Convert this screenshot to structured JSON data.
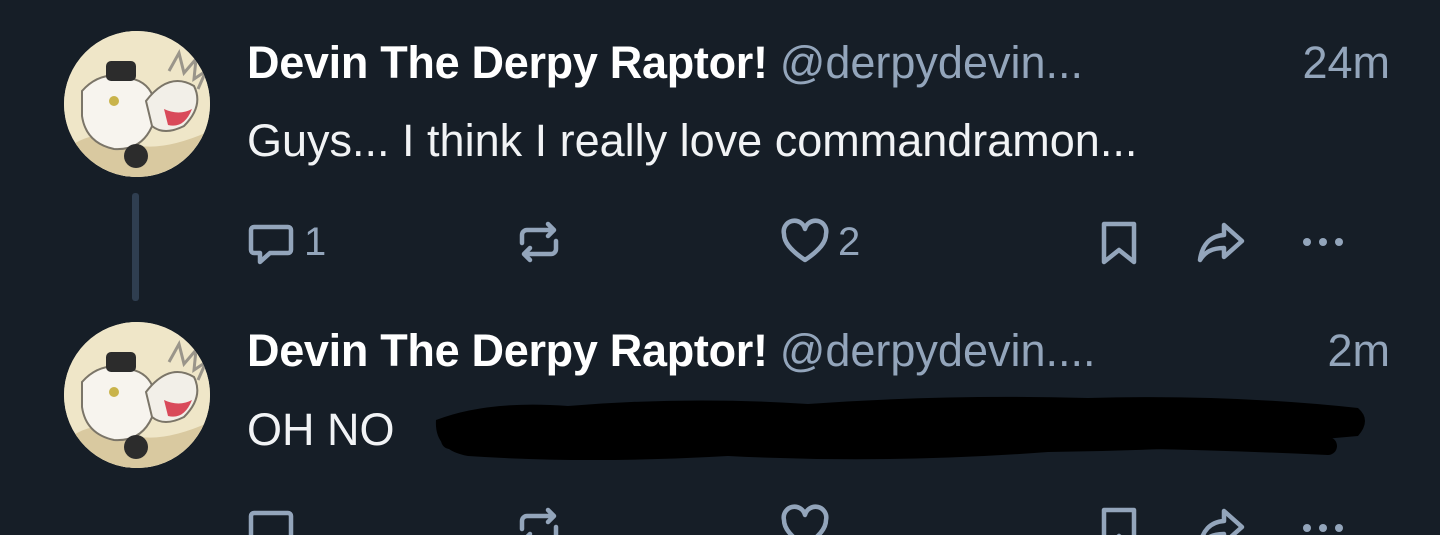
{
  "posts": [
    {
      "author": {
        "display_name": "Devin The Derpy Raptor!",
        "handle": "@derpydevin...",
        "avatar_icon": "raptor-avatar"
      },
      "timestamp": "24m",
      "text": "Guys... I think I really love commandramon...",
      "actions": {
        "reply_count": "1",
        "repost_count": "",
        "like_count": "2"
      }
    },
    {
      "author": {
        "display_name": "Devin The Derpy Raptor!",
        "handle": "@derpydevin....",
        "avatar_icon": "raptor-avatar"
      },
      "timestamp": "2m",
      "text": "OH NO",
      "redacted": true,
      "actions": {
        "reply_count": "",
        "repost_count": "",
        "like_count": ""
      }
    }
  ],
  "icons": {
    "reply": "reply-icon",
    "repost": "repost-icon",
    "like": "heart-icon",
    "save": "bookmark-icon",
    "share": "share-icon",
    "more": "more-icon"
  },
  "colors": {
    "background": "#161e27",
    "primary_text": "#ffffff",
    "secondary_text": "#93a5bb",
    "thread_line": "#2f3e50"
  }
}
